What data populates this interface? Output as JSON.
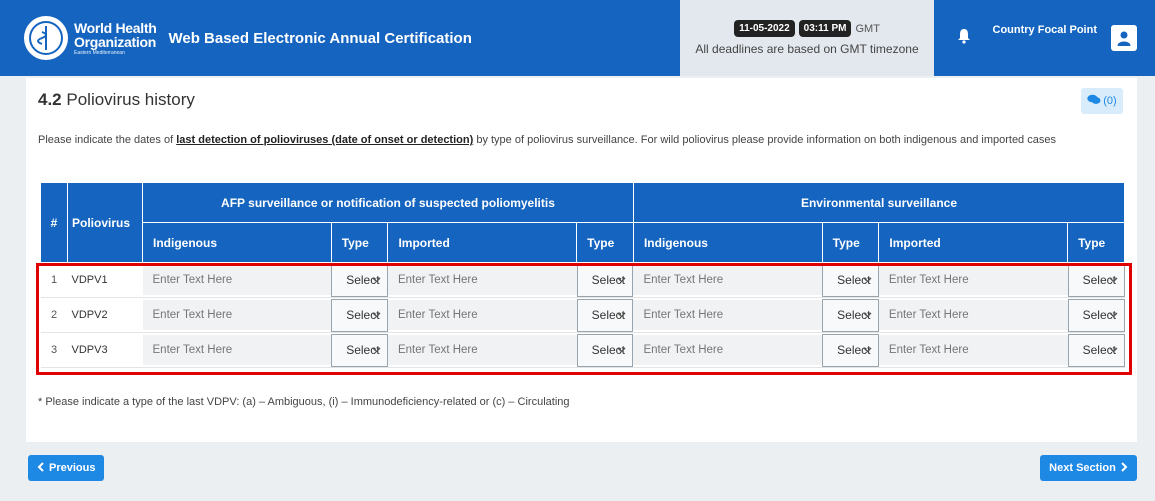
{
  "header": {
    "org_line1": "World Health",
    "org_line2": "Organization",
    "org_region": "Eastern Mediterranean",
    "app_title": "Web Based Electronic Annual Certification",
    "date": "11-05-2022",
    "time": "03:11 PM",
    "tz": "GMT",
    "deadline_note": "All deadlines are based on GMT timezone",
    "user_role": "Country Focal Point"
  },
  "section": {
    "number": "4.2",
    "title": "Poliovirus history",
    "comments": "(0)",
    "instr_pre": "Please indicate the dates of ",
    "instr_link": "last detection of polioviruses (date of onset or detection)",
    "instr_post": " by type of poliovirus surveillance. For wild poliovirus please provide information on both indigenous and imported cases",
    "footnote": "* Please indicate a type of the last VDPV: (a) – Ambiguous, (i) – Immunodeficiency-related or (c) – Circulating"
  },
  "table": {
    "col_hash": "#",
    "col_poliovirus": "Poliovirus",
    "group_afp": "AFP surveillance or notification of suspected poliomyelitis",
    "group_env": "Environmental surveillance",
    "sub": [
      "Indigenous",
      "Type",
      "Imported",
      "Type",
      "Indigenous",
      "Type",
      "Imported",
      "Type"
    ],
    "placeholder": "Enter Text Here",
    "select_value": "Select",
    "rows": [
      {
        "num": "1",
        "name": "VDPV1"
      },
      {
        "num": "2",
        "name": "VDPV2"
      },
      {
        "num": "3",
        "name": "VDPV3"
      }
    ]
  },
  "nav": {
    "previous": "Previous",
    "next": "Next Section"
  },
  "colors": {
    "brand": "#1565c0",
    "accent": "#1e88e5",
    "highlight": "#e00000"
  }
}
